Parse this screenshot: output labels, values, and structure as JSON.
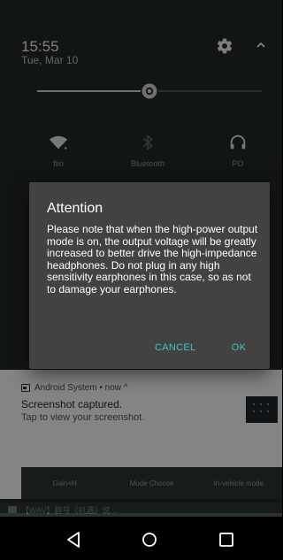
{
  "status": {
    "time": "15:55",
    "date": "Tue, Mar 10"
  },
  "brightness": {
    "level": 0.5
  },
  "quick_tiles": [
    {
      "label": "fiio",
      "icon": "wifi-icon",
      "active": true
    },
    {
      "label": "Bluetooth",
      "icon": "bluetooth-icon",
      "active": false
    },
    {
      "label": "PO",
      "icon": "headphones-icon",
      "active": true
    }
  ],
  "dialog": {
    "title": "Attention",
    "message": "Please note that when the high-power output mode is on, the output voltage will be greatly increased to better drive the high-impedance headphones. Do not plug in any high sensitivity earphones in this case, so as not to damage your earphones.",
    "cancel_label": "CANCEL",
    "ok_label": "OK"
  },
  "notification": {
    "app": "Android System • now ^",
    "title": "Screenshot captured.",
    "text": "Tap to view your screenshot.",
    "actions": [
      "Gain<H",
      "Mode Choose",
      "In-vehicle mode"
    ]
  },
  "drawer": {
    "text": "【WAV】群号《机遇》说..."
  },
  "colors": {
    "accent": "#40c4bf",
    "dialog_bg": "#424242",
    "shade_bg": "#222729"
  }
}
